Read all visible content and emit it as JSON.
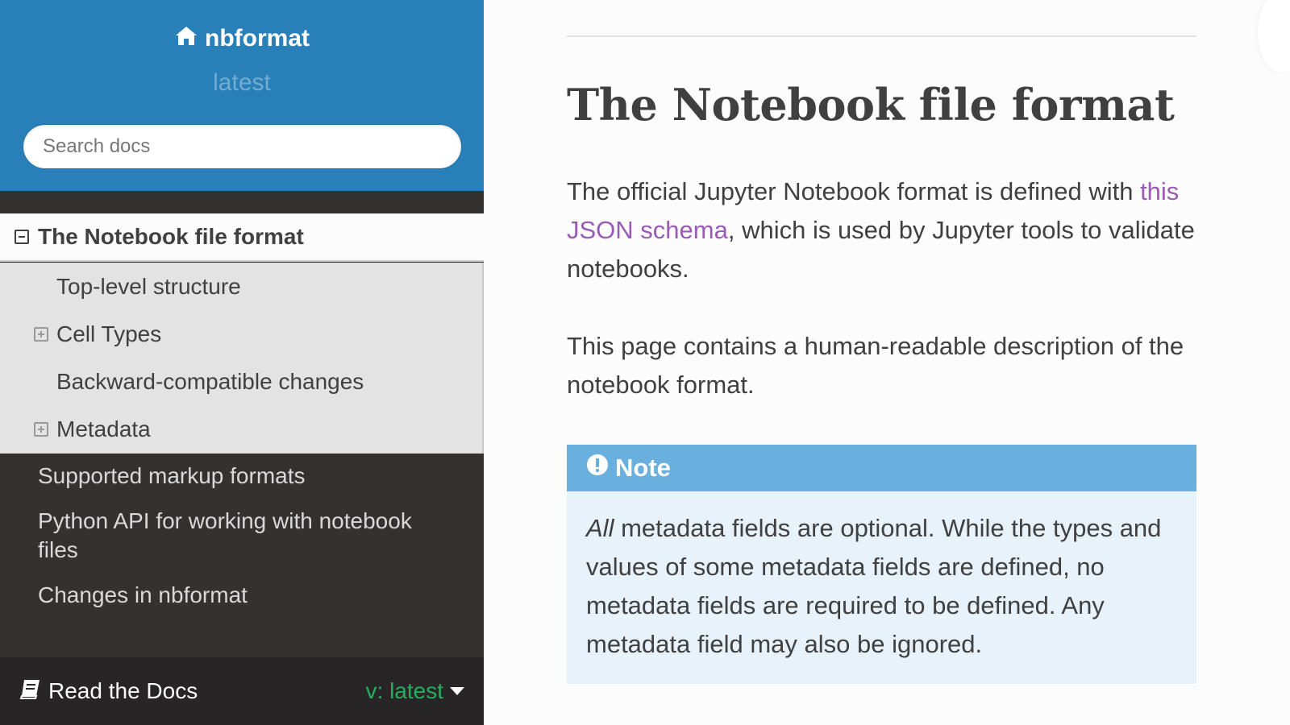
{
  "sidebar": {
    "brand": "nbformat",
    "version": "latest",
    "search_placeholder": "Search docs",
    "current": "The Notebook file format",
    "subitems": [
      {
        "label": "Top-level structure",
        "expandable": false
      },
      {
        "label": "Cell Types",
        "expandable": true
      },
      {
        "label": "Backward-compatible changes",
        "expandable": false
      },
      {
        "label": "Metadata",
        "expandable": true
      }
    ],
    "items": [
      "Supported markup formats",
      "Python API for working with notebook files",
      "Changes in nbformat"
    ],
    "footer": {
      "label": "Read the Docs",
      "version": "v: latest"
    }
  },
  "main": {
    "title": "The Notebook file format",
    "p1_before": "The official Jupyter Notebook format is defined with ",
    "p1_link": "this JSON schema",
    "p1_after": ", which is used by Jupyter tools to validate notebooks.",
    "p2": "This page contains a human-readable description of the notebook format.",
    "note": {
      "title": "Note",
      "emph": "All",
      "body": " metadata fields are optional. While the types and values of some metadata fields are defined, no metadata fields are required to be defined. Any metadata field may also be ignored."
    }
  },
  "colors": {
    "header_blue": "#2980b9",
    "sidebar_dark": "#343131",
    "link_purple": "#9b59b6",
    "note_header": "#6ab0de",
    "note_body": "#e7f2fa",
    "version_green": "#27ae60"
  },
  "icons": [
    "home-icon",
    "collapse-icon",
    "expand-icon",
    "book-icon",
    "caret-down-icon",
    "exclamation-circle-icon"
  ]
}
